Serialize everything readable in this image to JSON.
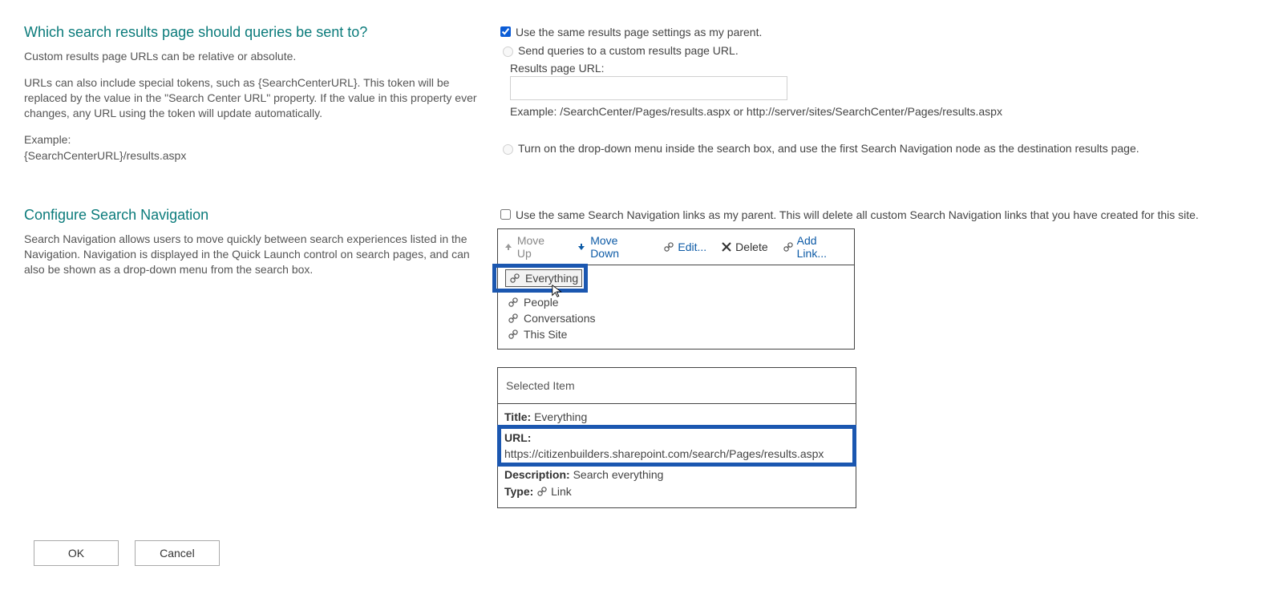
{
  "section1": {
    "title": "Which search results page should queries be sent to?",
    "descr1": "Custom results page URLs can be relative or absolute.",
    "descr2": "URLs can also include special tokens, such as {SearchCenterURL}. This token will be replaced by the value in the \"Search Center URL\" property. If the value in this property ever changes, any URL using the token will update automatically.",
    "descr3": "Example:",
    "descr4": "{SearchCenterURL}/results.aspx",
    "opt_same_parent": "Use the same results page settings as my parent.",
    "opt_custom": "Send queries to a custom results page URL.",
    "results_url_label": "Results page URL:",
    "example_text": "Example: /SearchCenter/Pages/results.aspx or http://server/sites/SearchCenter/Pages/results.aspx",
    "opt_dropdown": "Turn on the drop-down menu inside the search box, and use the first Search Navigation node as the destination results page."
  },
  "section2": {
    "title": "Configure Search Navigation",
    "descr": "Search Navigation allows users to move quickly between search experiences listed in the Navigation. Navigation is displayed in the Quick Launch control on search pages, and can also be shown as a drop-down menu from the search box.",
    "opt_same_nav": "Use the same Search Navigation links as my parent. This will delete all custom Search Navigation links that you have created for this site."
  },
  "toolbar": {
    "move_up": "Move Up",
    "move_down": "Move Down",
    "edit": "Edit...",
    "delete": "Delete",
    "add_link": "Add Link..."
  },
  "nav_items": {
    "i0": "Everything",
    "i1": "People",
    "i2": "Conversations",
    "i3": "This Site"
  },
  "selected": {
    "header": "Selected Item",
    "title_label": "Title:",
    "title_value": "Everything",
    "url_label": "URL:",
    "url_value": "https://citizenbuilders.sharepoint.com/search/Pages/results.aspx",
    "desc_label": "Description:",
    "desc_value": "Search everything",
    "type_label": "Type:",
    "type_value": "Link"
  },
  "buttons": {
    "ok": "OK",
    "cancel": "Cancel"
  }
}
